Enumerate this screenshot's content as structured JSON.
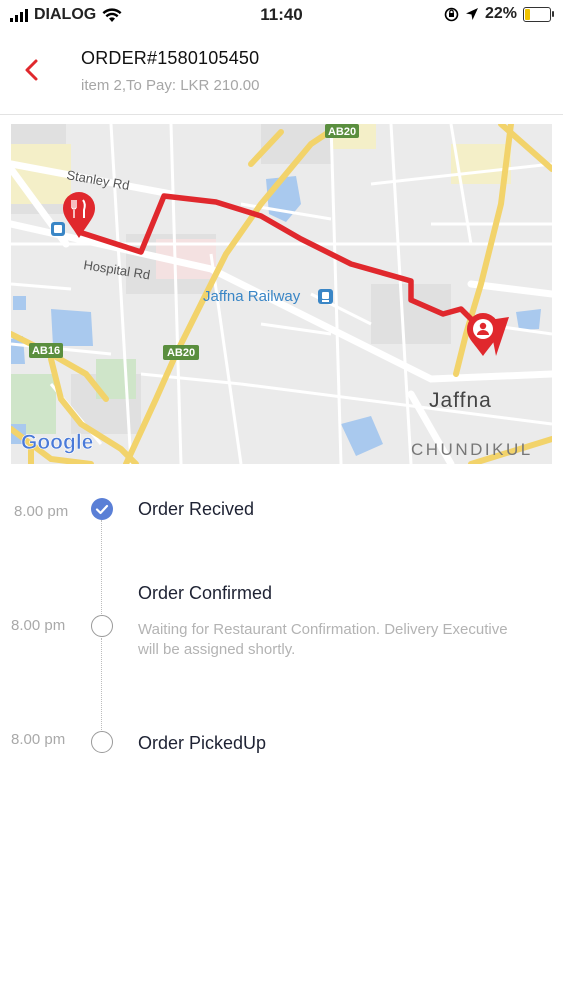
{
  "status_bar": {
    "carrier": "DIALOG",
    "time": "11:40",
    "battery_percent": "22%",
    "battery_level": 0.22
  },
  "header": {
    "back_icon": "chevron-left-icon",
    "title": "ORDER#1580105450",
    "subtitle": "item 2,To Pay: LKR 210.00",
    "accent_color": "#e0282d"
  },
  "map": {
    "labels": {
      "stanley_rd": "Stanley Rd",
      "hospital_rd": "Hospital Rd",
      "railway": "Jaffna Railway",
      "city": "Jaffna",
      "district": "CHUNDIKUL",
      "ab20_top": "AB20",
      "ab20_mid": "AB20",
      "ab16": "AB16",
      "google": "Google"
    },
    "route_color": "#e0282d",
    "restaurant_icon": "fork-knife-pin-icon",
    "customer_icon": "user-pin-icon"
  },
  "timeline": {
    "steps": [
      {
        "time": "8.00 pm",
        "title": "Order Recived",
        "status": "done"
      },
      {
        "time": "8.00 pm",
        "title": "Order Confirmed",
        "description": "Waiting for Restaurant Confirmation. Delivery Executive will be assigned shortly.",
        "status": "pending"
      },
      {
        "time": "8.00 pm",
        "title": "Order PickedUp",
        "status": "pending"
      }
    ],
    "done_color": "#5a7fd6"
  }
}
